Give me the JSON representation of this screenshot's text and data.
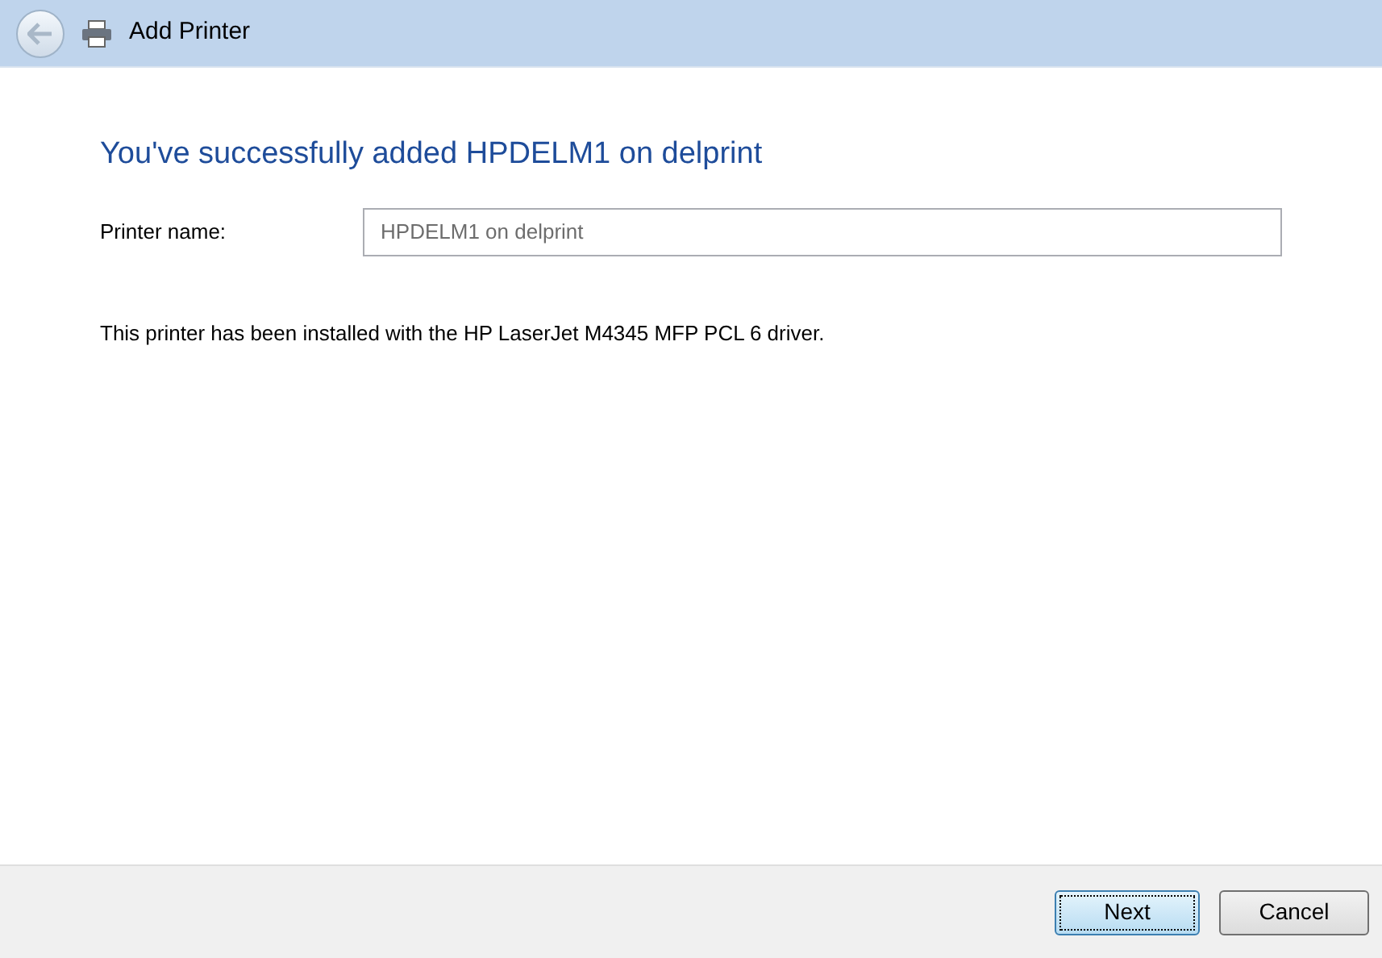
{
  "window": {
    "title": "Add Printer"
  },
  "heading": "You've successfully added HPDELM1 on delprint",
  "printer_name": {
    "label": "Printer name:",
    "value": "HPDELM1 on delprint"
  },
  "message": "This printer has been installed with the HP LaserJet M4345 MFP PCL 6 driver.",
  "buttons": [
    {
      "label": "Next",
      "default": true
    },
    {
      "label": "Cancel",
      "default": false
    }
  ]
}
